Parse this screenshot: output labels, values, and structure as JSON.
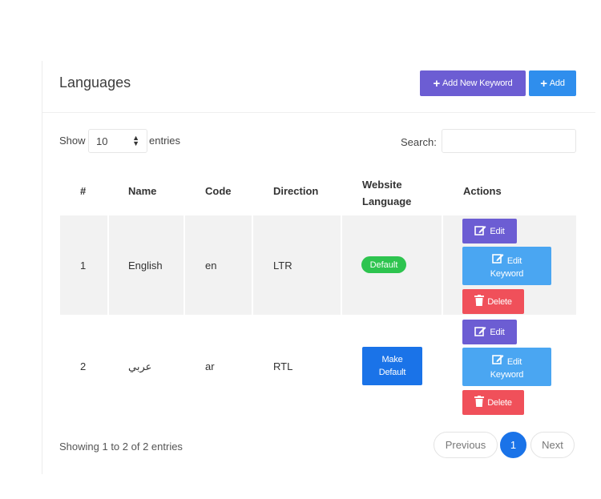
{
  "header": {
    "title": "Languages",
    "add_keyword_label": "Add New Keyword",
    "add_label": "Add"
  },
  "controls": {
    "show_label": "Show",
    "entries_value": "10",
    "entries_label": "entries",
    "search_label": "Search:"
  },
  "table": {
    "headers": {
      "num": "#",
      "name": "Name",
      "code": "Code",
      "direction": "Direction",
      "website_language_line1": "Website",
      "website_language_line2": "Language",
      "actions": "Actions"
    },
    "rows": [
      {
        "num": "1",
        "name": "English",
        "code": "en",
        "direction": "LTR",
        "status": "Default"
      },
      {
        "num": "2",
        "name": "عربي",
        "code": "ar",
        "direction": "RTL",
        "make_default_line1": "Make",
        "make_default_line2": "Default"
      }
    ],
    "actions": {
      "edit": "Edit",
      "edit_keyword_line1": "Edit",
      "edit_keyword_line2": "Keyword",
      "delete": "Delete"
    }
  },
  "footer": {
    "info": "Showing 1 to 2 of 2 entries",
    "previous": "Previous",
    "page": "1",
    "next": "Next"
  },
  "colors": {
    "purple": "#6c5dd3",
    "blue": "#2f8eed",
    "light_blue": "#4aa6f2",
    "red": "#f0505a",
    "green": "#2ec44f",
    "row_alt": "#f2f2f2"
  }
}
